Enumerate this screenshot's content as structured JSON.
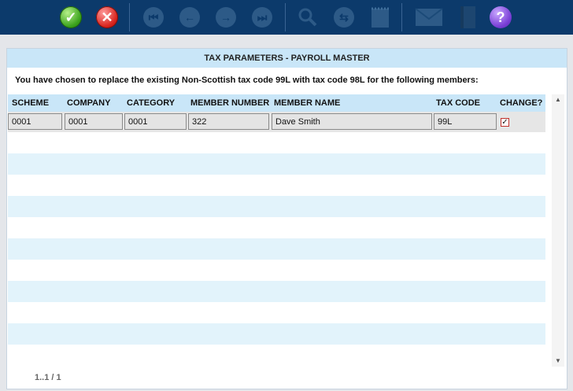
{
  "toolbar": {
    "icons": [
      "check-icon",
      "cancel-icon",
      "first-icon",
      "previous-icon",
      "next-icon",
      "last-icon",
      "search-icon",
      "refresh-icon",
      "notepad-icon",
      "email-icon",
      "book-icon",
      "help-icon"
    ],
    "help_glyph": "?"
  },
  "panel": {
    "title": "TAX PARAMETERS - PAYROLL MASTER",
    "message": "You have chosen to replace the existing Non-Scottish tax code 99L with tax code 98L for the following members:"
  },
  "table": {
    "headers": [
      "SCHEME",
      "COMPANY",
      "CATEGORY",
      "MEMBER NUMBER",
      "MEMBER NAME",
      "TAX CODE",
      "CHANGE?"
    ],
    "rows": [
      {
        "scheme": "0001",
        "company": "0001",
        "category": "0001",
        "member_number": "322",
        "member_name": "Dave Smith",
        "tax_code": "99L",
        "change": true
      }
    ]
  },
  "pager": {
    "text": "1..1 / 1"
  }
}
